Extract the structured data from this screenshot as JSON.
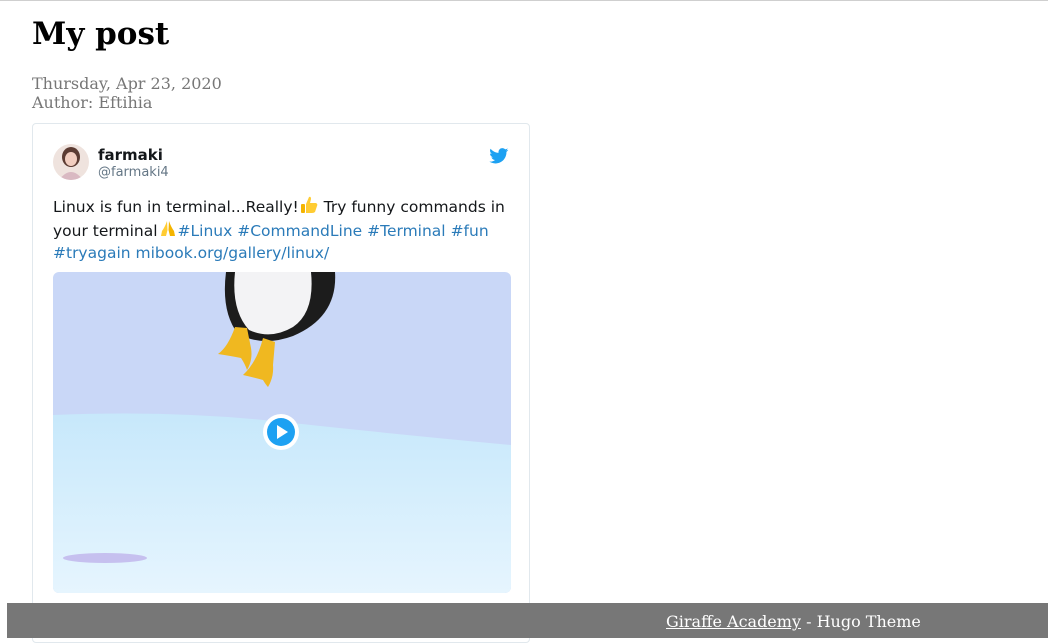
{
  "post": {
    "title": "My post",
    "date": "Thursday, Apr 23, 2020",
    "author": "Author: Eftihia"
  },
  "tweet": {
    "display_name": "farmaki",
    "handle": "@farmaki4",
    "text_part1": "Linux is fun in terminal...Really!",
    "text_part2": " Try funny commands in your terminal",
    "hashtags": [
      "#Linux",
      "#CommandLine",
      "#Terminal",
      "#fun",
      "#tryagain"
    ],
    "link": "mibook.org/gallery/linux/",
    "media_icon": "play-icon",
    "brand_color": "#1da1f2",
    "link_color": "#2b7bb9"
  },
  "footer": {
    "link_label": "Giraffe Academy",
    "suffix": " - Hugo Theme"
  }
}
